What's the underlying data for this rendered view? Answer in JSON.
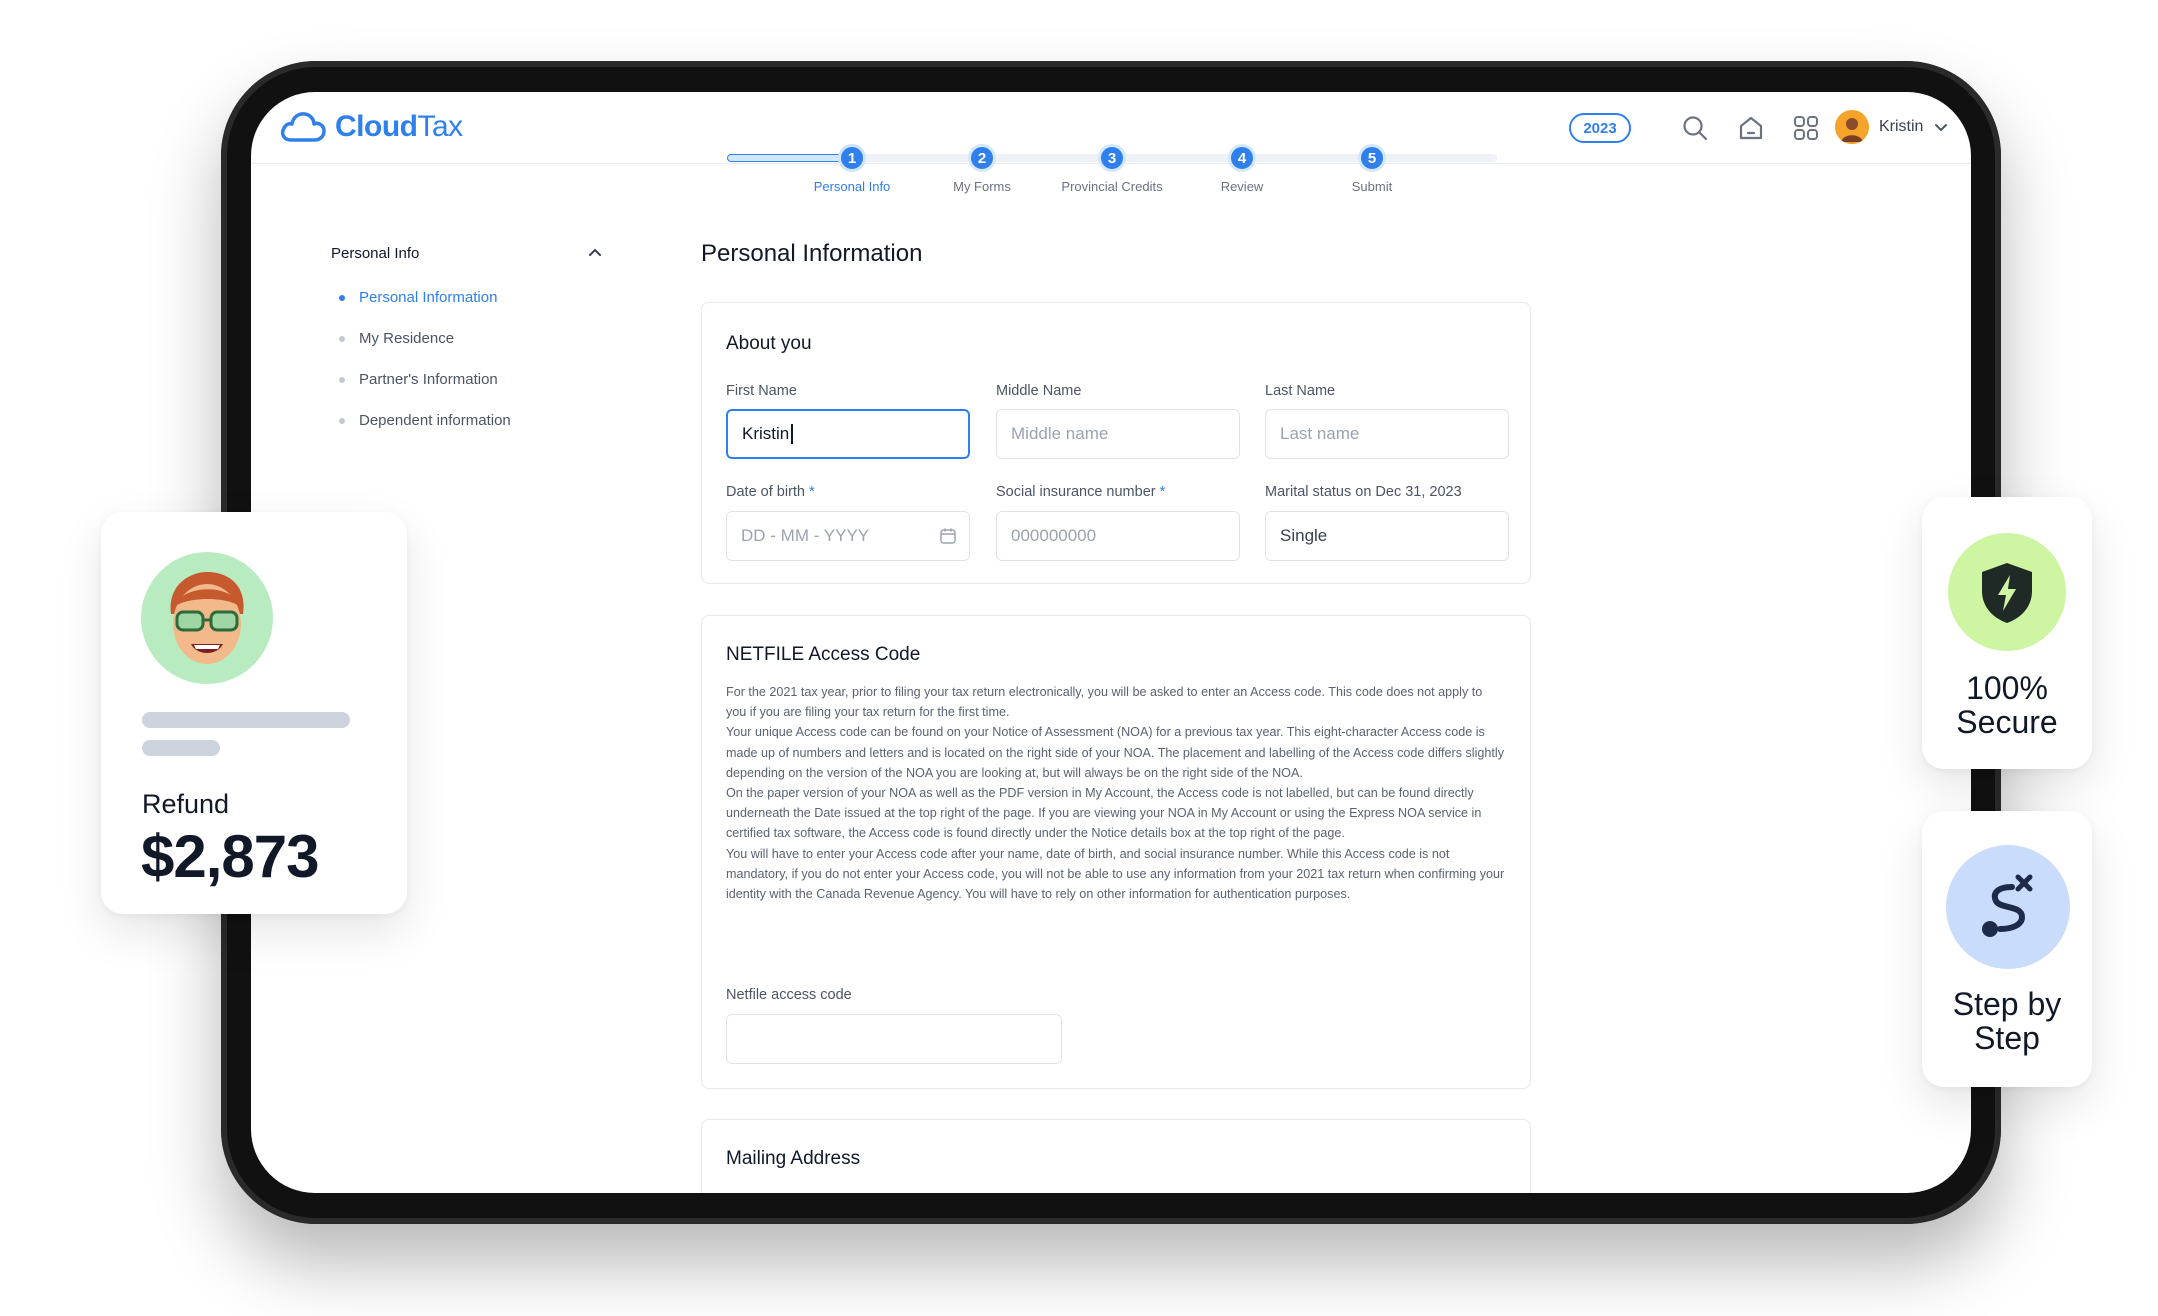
{
  "app": {
    "logo_cloud": "Cloud",
    "logo_tax": "Tax"
  },
  "header": {
    "year": "2023",
    "user_name": "Kristin"
  },
  "stepper": {
    "steps": [
      {
        "num": "1",
        "label": "Personal Info"
      },
      {
        "num": "2",
        "label": "My Forms"
      },
      {
        "num": "3",
        "label": "Provincial Credits"
      },
      {
        "num": "4",
        "label": "Review"
      },
      {
        "num": "5",
        "label": "Submit"
      }
    ],
    "active_step": 1
  },
  "sidebar": {
    "title": "Personal Info",
    "items": [
      "Personal Information",
      "My Residence",
      "Partner's Information",
      "Dependent information"
    ]
  },
  "main": {
    "title": "Personal Information",
    "about": {
      "title": "About you",
      "first_name_label": "First Name",
      "first_name_value": "Kristin",
      "middle_name_label": "Middle Name",
      "middle_name_placeholder": "Middle name",
      "last_name_label": "Last Name",
      "last_name_placeholder": "Last name",
      "dob_label": "Date of birth",
      "dob_placeholder": "DD - MM - YYYY",
      "sin_label": "Social insurance number",
      "sin_placeholder": "000000000",
      "marital_label": "Marital status on Dec 31, 2023",
      "marital_value": "Single",
      "required_mark": "*"
    },
    "netfile": {
      "title": "NETFILE Access Code",
      "paragraphs": [
        "For the 2021 tax year, prior to filing your tax return electronically, you will be asked to enter an Access code. This code does not apply to you if you are filing your tax return for the first time.",
        "Your unique Access code can be found on your Notice of Assessment (NOA) for a previous tax year. This eight-character Access code is made up of numbers and letters and is located on the right side of your NOA. The placement and labelling of the Access code differs slightly depending on the version of the NOA you are looking at, but will always be on the right side of the NOA.",
        "On the paper version of your NOA as well as the PDF version in My Account, the Access code is not labelled, but can be found directly underneath the Date issued at the top right of the page. If you are viewing your NOA in My Account or using the Express NOA service in certified tax software, the Access code is found directly under the Notice details box at the top right of the page.",
        "You will have to enter your Access code after your name, date of birth, and social insurance number. While this Access code is not mandatory, if you do not enter your Access code, you will not be able to use any information from your 2021 tax return when confirming your identity with the Canada Revenue Agency. You will have to rely on other information for authentication purposes."
      ],
      "field_label": "Netfile access code",
      "field_value": ""
    },
    "mailing": {
      "title": "Mailing Address"
    }
  },
  "refund_card": {
    "label": "Refund",
    "amount": "$2,873"
  },
  "secure_card": {
    "line1": "100%",
    "line2": "Secure"
  },
  "step_card": {
    "line1": "Step by",
    "line2": "Step"
  },
  "colors": {
    "accent": "#2f80ed",
    "secure_bg": "#cdf5a2",
    "step_bg": "#c9dcfb",
    "avatar_bg": "#b8ecc0"
  },
  "icons": [
    "cloud-icon",
    "search-icon",
    "home-icon",
    "grid-icon",
    "chevron-down-icon",
    "chevron-up-icon",
    "calendar-icon",
    "shield-bolt-icon",
    "route-icon"
  ]
}
